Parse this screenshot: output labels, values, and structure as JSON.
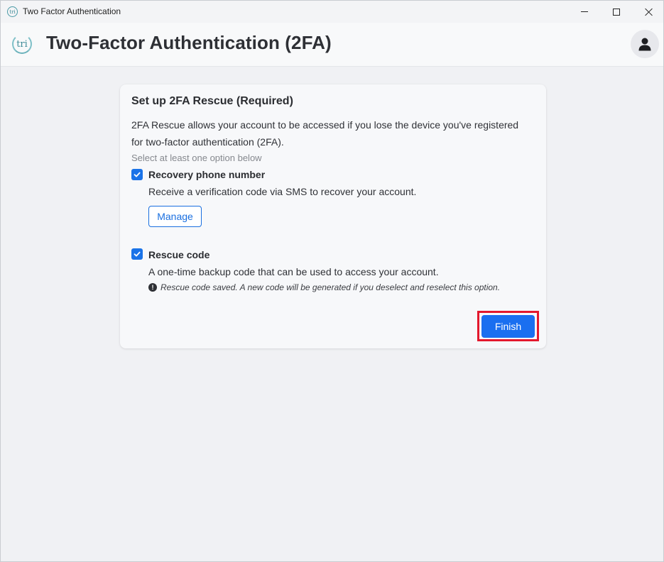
{
  "window": {
    "title": "Two Factor Authentication",
    "app_icon_text": "tri"
  },
  "header": {
    "logo_text": "tri",
    "title": "Two-Factor Authentication (2FA)"
  },
  "card": {
    "title": "Set up 2FA Rescue (Required)",
    "description": "2FA Rescue allows your account to be accessed if you lose the device you've registered for two-factor authentication (2FA).",
    "hint": "Select at least one option below",
    "options": [
      {
        "label": "Recovery phone number",
        "description": "Receive a verification code via SMS to recover your account.",
        "checked": true,
        "action_label": "Manage"
      },
      {
        "label": "Rescue code",
        "description": "A one-time backup code that can be used to access your account.",
        "checked": true,
        "note": "Rescue code saved. A new code will be generated if you deselect and reselect this option."
      }
    ],
    "finish_label": "Finish"
  },
  "colors": {
    "accent": "#1a6ff0",
    "highlight": "#e3182d",
    "logo": "#3f8c98"
  },
  "icons": {
    "minimize": "minimize-icon",
    "maximize": "maximize-icon",
    "close": "close-icon",
    "avatar": "user-icon",
    "check": "check-icon",
    "info": "exclamation-circle-icon"
  }
}
